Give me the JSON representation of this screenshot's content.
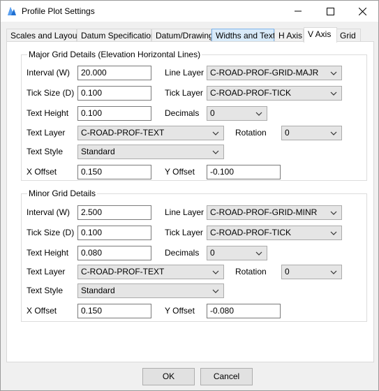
{
  "window": {
    "title": "Profile Plot Settings",
    "minimize_icon": "minimize-icon",
    "maximize_icon": "maximize-icon",
    "close_icon": "close-icon"
  },
  "tabs": [
    {
      "label": "Scales and Layout"
    },
    {
      "label": "Datum Specification"
    },
    {
      "label": "Datum/Drawing"
    },
    {
      "label": "Widths and Text"
    },
    {
      "label": "H Axis"
    },
    {
      "label": "V Axis"
    },
    {
      "label": "Grid"
    }
  ],
  "major": {
    "legend": "Major Grid Details (Elevation Horizontal Lines)",
    "interval_label": "Interval (W)",
    "interval": "20.000",
    "line_layer_label": "Line Layer",
    "line_layer": "C-ROAD-PROF-GRID-MAJR",
    "tick_size_label": "Tick Size (D)",
    "tick_size": "0.100",
    "tick_layer_label": "Tick Layer",
    "tick_layer": "C-ROAD-PROF-TICK",
    "text_height_label": "Text Height",
    "text_height": "0.100",
    "decimals_label": "Decimals",
    "decimals": "0",
    "text_layer_label": "Text Layer",
    "text_layer": "C-ROAD-PROF-TEXT",
    "rotation_label": "Rotation",
    "rotation": "0",
    "text_style_label": "Text Style",
    "text_style": "Standard",
    "x_offset_label": "X Offset",
    "x_offset": "0.150",
    "y_offset_label": "Y Offset",
    "y_offset": "-0.100"
  },
  "minor": {
    "legend": "Minor Grid Details",
    "interval_label": "Interval (W)",
    "interval": "2.500",
    "line_layer_label": "Line Layer",
    "line_layer": "C-ROAD-PROF-GRID-MINR",
    "tick_size_label": "Tick Size (D)",
    "tick_size": "0.100",
    "tick_layer_label": "Tick Layer",
    "tick_layer": "C-ROAD-PROF-TICK",
    "text_height_label": "Text Height",
    "text_height": "0.080",
    "decimals_label": "Decimals",
    "decimals": "0",
    "text_layer_label": "Text Layer",
    "text_layer": "C-ROAD-PROF-TEXT",
    "rotation_label": "Rotation",
    "rotation": "0",
    "text_style_label": "Text Style",
    "text_style": "Standard",
    "x_offset_label": "X Offset",
    "x_offset": "0.150",
    "y_offset_label": "Y Offset",
    "y_offset": "-0.080"
  },
  "buttons": {
    "ok": "OK",
    "cancel": "Cancel"
  },
  "colors": {
    "tab_hover": "#d8eaf9",
    "app_icon": "#1f6fd1"
  }
}
